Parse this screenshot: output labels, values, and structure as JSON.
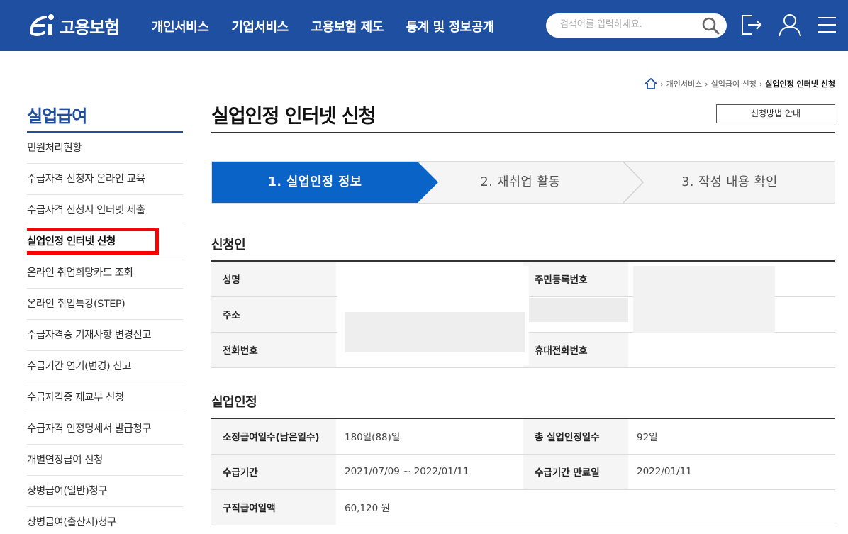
{
  "header": {
    "logo_text": "고용보험",
    "nav": [
      "개인서비스",
      "기업서비스",
      "고용보험 제도",
      "통계 및 정보공개"
    ],
    "search_placeholder": "검색어를 입력하세요."
  },
  "breadcrumb": {
    "items": [
      "개인서비스",
      "실업급여 신청"
    ],
    "current": "실업인정 인터넷 신청"
  },
  "sidebar": {
    "title": "실업급여",
    "items": [
      "민원처리현황",
      "수급자격 신청자 온라인 교육",
      "수급자격 신청서 인터넷 제출",
      "실업인정 인터넷 신청",
      "온라인 취업희망카드 조회",
      "온라인 취업특강(STEP)",
      "수급자격증 기재사항 변경신고",
      "수급기간 연기(변경) 신고",
      "수급자격증 재교부 신청",
      "수급자격 인정명세서 발급청구",
      "개별연장급여 신청",
      "상병급여(일반)청구",
      "상병급여(출산시)청구"
    ],
    "active_index": 3
  },
  "main": {
    "title": "실업인정 인터넷 신청",
    "guide_button": "신청방법 안내",
    "steps": [
      "1. 실업인정 정보",
      "2. 재취업 활동",
      "3. 작성 내용 확인"
    ],
    "applicant": {
      "title": "신청인",
      "rows": [
        [
          "성명",
          "",
          "주민등록번호",
          ""
        ],
        [
          "주소",
          "",
          "",
          ""
        ],
        [
          "전화번호",
          "",
          "휴대전화번호",
          ""
        ]
      ]
    },
    "unemployment": {
      "title": "실업인정",
      "rows": [
        [
          "소정급여일수(남은일수)",
          "180일(88)일",
          "총 실업인정일수",
          "92일"
        ],
        [
          "수급기간",
          "2021/07/09 ~ 2022/01/11",
          "수급기간 만료일",
          "2022/01/11"
        ],
        [
          "구직급여일액",
          "60,120 원",
          "",
          ""
        ]
      ]
    }
  },
  "colors": {
    "header_bg": "#1f4fa1",
    "step_active": "#0a63c7",
    "highlight": "#ff0000"
  }
}
